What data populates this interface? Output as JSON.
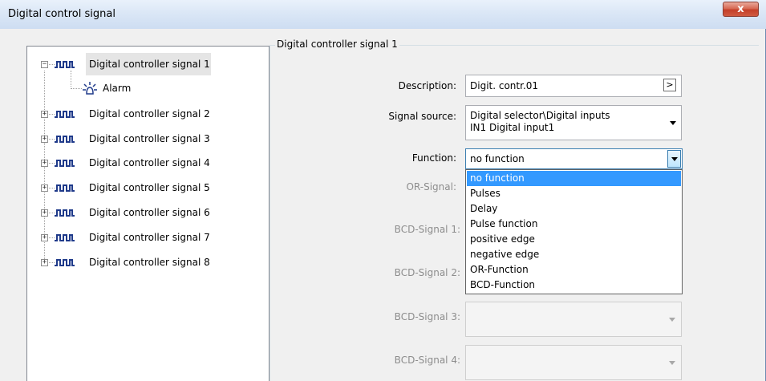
{
  "window": {
    "title": "Digital control signal",
    "close_glyph": "x"
  },
  "tree": {
    "items": [
      {
        "label": "Digital controller signal 1",
        "expander": "−"
      },
      {
        "label": "Alarm"
      },
      {
        "label": "Digital controller signal 2",
        "expander": "+"
      },
      {
        "label": "Digital controller signal 3",
        "expander": "+"
      },
      {
        "label": "Digital controller signal 4",
        "expander": "+"
      },
      {
        "label": "Digital controller signal 5",
        "expander": "+"
      },
      {
        "label": "Digital controller signal 6",
        "expander": "+"
      },
      {
        "label": "Digital controller signal 7",
        "expander": "+"
      },
      {
        "label": "Digital controller signal 8",
        "expander": "+"
      }
    ]
  },
  "panel": {
    "title": "Digital controller signal 1",
    "description_label": "Description:",
    "description_value": "Digit. contr.01",
    "ellipsis": ">",
    "source_label": "Signal source:",
    "source_line1": "Digital selector\\Digital inputs",
    "source_line2": "IN1 Digital input1",
    "function_label": "Function:",
    "function_value": "no function",
    "or_label": "OR-Signal:",
    "bcd1_label": "BCD-Signal 1:",
    "bcd2_label": "BCD-Signal 2:",
    "bcd3_label": "BCD-Signal 3:",
    "bcd4_label": "BCD-Signal 4:"
  },
  "function_options": [
    "no function",
    "Pulses",
    "Delay",
    "Pulse function",
    "positive edge",
    "negative edge",
    "OR-Function",
    "BCD-Function"
  ],
  "colors": {
    "selection": "#3399ff",
    "title_bar": "#dbe7f6",
    "close": "#c4402a"
  }
}
